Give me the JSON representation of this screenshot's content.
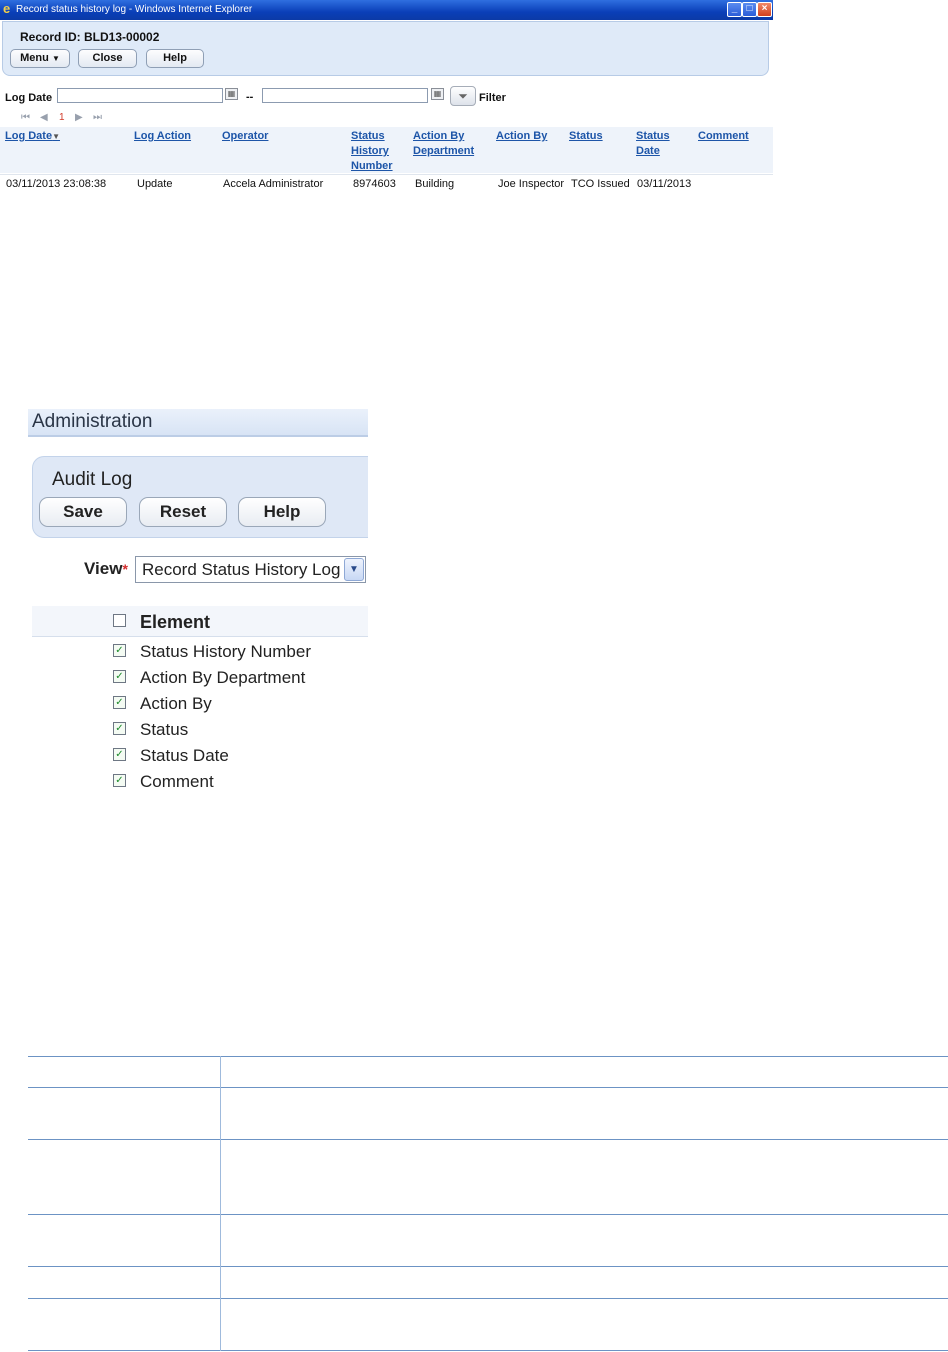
{
  "ie_window": {
    "title": "Record status history log - Windows Internet Explorer",
    "record_id": "Record ID: BLD13-00002",
    "buttons": {
      "menu": "Menu",
      "close": "Close",
      "help": "Help"
    },
    "filter": {
      "label": "Log Date",
      "from_value": "",
      "to_value": "",
      "separator": "--",
      "filter_label": "Filter"
    },
    "pager": {
      "current_page": "1"
    },
    "grid": {
      "columns": [
        "Log Date",
        "Log Action",
        "Operator",
        "Status History Number",
        "Action By Department",
        "Action By",
        "Status",
        "Status Date",
        "Comment"
      ],
      "rows": [
        [
          "03/11/2013 23:08:38",
          "Update",
          "Accela Administrator",
          "8974603",
          "Building",
          "Joe Inspector",
          "TCO Issued",
          "03/11/2013",
          ""
        ]
      ]
    }
  },
  "admin": {
    "section_title": "Administration",
    "panel_title": "Audit Log",
    "buttons": {
      "save": "Save",
      "reset": "Reset",
      "help": "Help"
    },
    "view_label": "View",
    "required_mark": "*",
    "view_value": "Record Status History Log",
    "element_header": "Element",
    "elements": [
      {
        "label": "Status History Number",
        "checked": true
      },
      {
        "label": "Action By Department",
        "checked": true
      },
      {
        "label": "Action By",
        "checked": true
      },
      {
        "label": "Status",
        "checked": true
      },
      {
        "label": "Status Date",
        "checked": true
      },
      {
        "label": "Comment",
        "checked": true
      }
    ]
  }
}
